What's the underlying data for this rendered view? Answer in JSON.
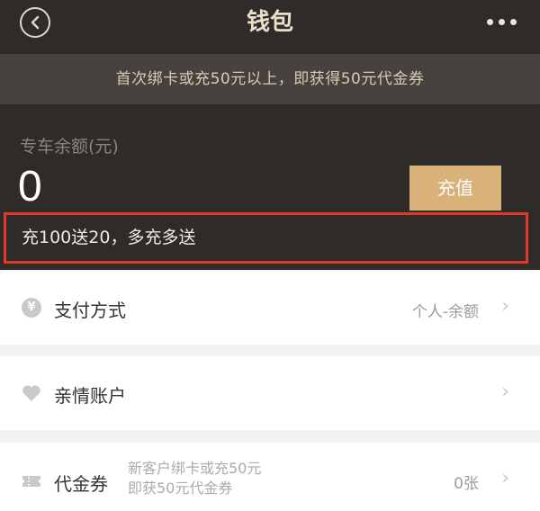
{
  "header": {
    "title": "钱包",
    "back_icon": "back-circle-icon",
    "more_icon": "more-dots-icon"
  },
  "banner": {
    "text": "首次绑卡或充50元以上，即获得50元代金券"
  },
  "balance": {
    "label": "专车余额(元)",
    "value": "0",
    "recharge_label": "充值"
  },
  "promo": {
    "text": "充100送20，多充多送"
  },
  "rows": {
    "payment": {
      "label": "支付方式",
      "value": "个人-余额",
      "icon": "yuan-coin-icon"
    },
    "family": {
      "label": "亲情账户",
      "icon": "heart-icon"
    },
    "voucher": {
      "label": "代金券",
      "desc_line1": "新客户绑卡或充50元",
      "desc_line2": "即获50元代金券",
      "value": "0张",
      "icon": "ticket-icon"
    }
  },
  "colors": {
    "dark_bg": "#2e2b28",
    "accent_gold": "#d9b27a",
    "highlight_red": "#e0392a"
  }
}
